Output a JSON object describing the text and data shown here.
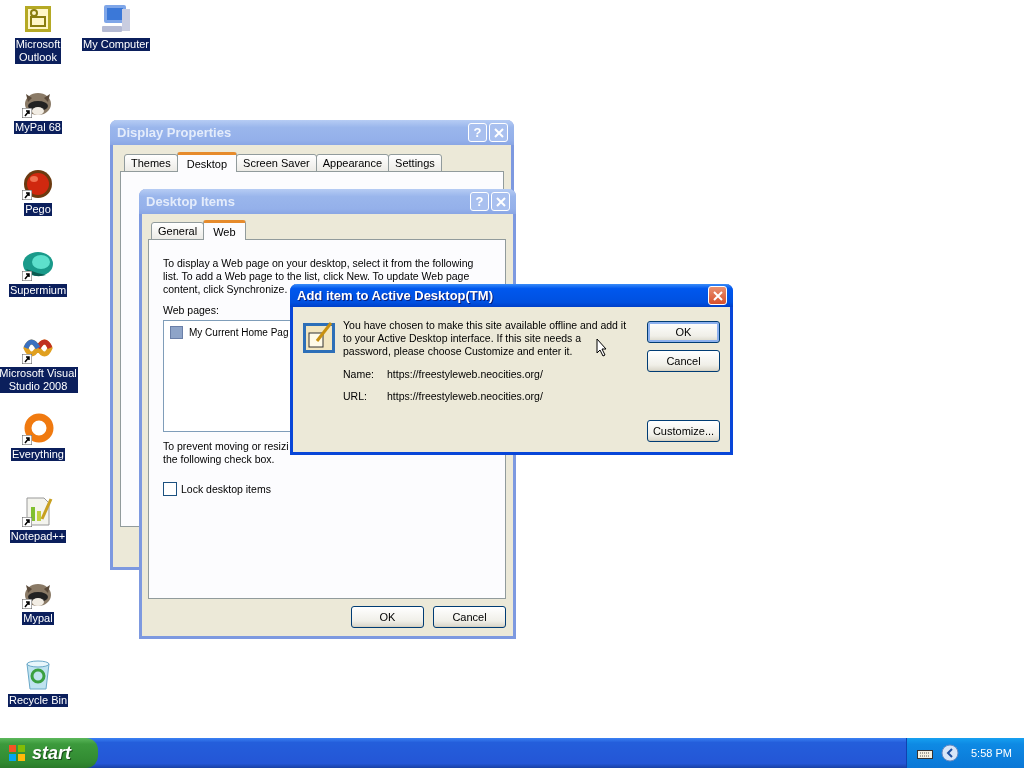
{
  "desktop_icons": [
    {
      "label": "Microsoft\nOutlook",
      "kind": "outlook",
      "shortcut": false
    },
    {
      "label": "My Computer",
      "kind": "computer",
      "shortcut": false
    },
    {
      "label": "MyPal 68",
      "kind": "raccoon",
      "shortcut": true
    },
    {
      "label": "Pego",
      "kind": "orb",
      "shortcut": true
    },
    {
      "label": "Supermium",
      "kind": "blob",
      "shortcut": true
    },
    {
      "label": "Microsoft Visual\nStudio 2008",
      "kind": "infinity",
      "shortcut": true
    },
    {
      "label": "Everything",
      "kind": "ring",
      "shortcut": true
    },
    {
      "label": "Notepad++",
      "kind": "notepad",
      "shortcut": true
    },
    {
      "label": "Mypal",
      "kind": "raccoon",
      "shortcut": true
    },
    {
      "label": "Recycle Bin",
      "kind": "bin",
      "shortcut": false
    }
  ],
  "display_properties": {
    "title": "Display Properties",
    "active": false,
    "help_button": "?",
    "tabs": [
      {
        "label": "Themes",
        "selected": false
      },
      {
        "label": "Desktop",
        "selected": true
      },
      {
        "label": "Screen Saver",
        "selected": false
      },
      {
        "label": "Appearance",
        "selected": false
      },
      {
        "label": "Settings",
        "selected": false
      }
    ]
  },
  "desktop_items": {
    "title": "Desktop Items",
    "active": false,
    "help_button": "?",
    "tabs": [
      {
        "label": "General",
        "selected": false
      },
      {
        "label": "Web",
        "selected": true
      }
    ],
    "intro_lines": [
      "To display a Web page on your desktop, select it from the following",
      "list. To add a Web page to the list, click New.  To update Web page",
      "content, click Synchronize."
    ],
    "web_pages_label": "Web pages:",
    "web_pages": [
      {
        "label": "My Current Home Pag",
        "checked": false
      }
    ],
    "lock_lines": [
      "To prevent moving or resizi",
      "the following check box."
    ],
    "lock_checkbox": {
      "label": "Lock desktop items",
      "checked": false
    },
    "buttons": [
      {
        "label": "OK",
        "default": false
      },
      {
        "label": "Cancel",
        "default": false
      }
    ]
  },
  "add_item": {
    "title": "Add item to Active Desktop(TM)",
    "active": true,
    "message_lines": [
      "You have chosen to make this site available offline and add it",
      "to your Active Desktop interface. If this site needs a",
      "password, please choose Customize and enter it."
    ],
    "fields": [
      {
        "label": "Name:",
        "value": "https://freestyleweb.neocities.org/"
      },
      {
        "label": "URL:",
        "value": "https://freestyleweb.neocities.org/"
      }
    ],
    "buttons": [
      {
        "label": "OK",
        "default": true
      },
      {
        "label": "Cancel",
        "default": false
      }
    ],
    "customize_button": {
      "label": "Customize...",
      "default": false
    }
  },
  "taskbar": {
    "start": "start",
    "clock": "5:58 PM"
  }
}
